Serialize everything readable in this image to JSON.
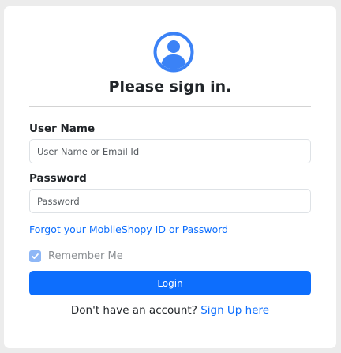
{
  "header": {
    "avatar_icon": "user-circle-icon",
    "title": "Please sign in."
  },
  "form": {
    "username": {
      "label": "User Name",
      "placeholder": "User Name or Email Id",
      "value": ""
    },
    "password": {
      "label": "Password",
      "placeholder": "Password",
      "value": ""
    },
    "forgot_link": "Forgot your MobileShopy ID or Password",
    "remember": {
      "label": "Remember Me",
      "checked": true
    },
    "login_label": "Login"
  },
  "footer": {
    "prompt": "Don't have an account?",
    "signup_link": "Sign Up here"
  },
  "colors": {
    "accent": "#0d6efd",
    "checkbox_fill": "#8eb7f6",
    "avatar": "#3b82f6"
  }
}
